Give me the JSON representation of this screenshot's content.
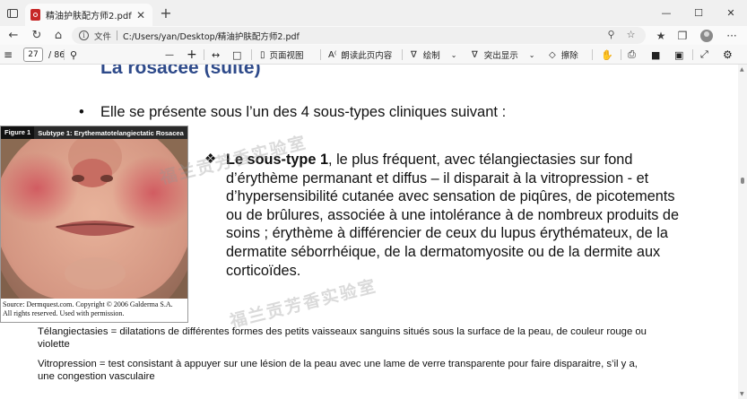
{
  "browser": {
    "tab_title": "精油护肤配方师2.pdf",
    "tab_close": "✕",
    "new_tab": "+",
    "window_controls": [
      "—",
      "☐",
      "✕"
    ],
    "file_label": "文件",
    "url": "C:/Users/yan/Desktop/精油护肤配方师2.pdf",
    "more_menu": "···"
  },
  "pdf_toolbar": {
    "current_page": "27",
    "total_pages": "/ 86",
    "zoom_out": "—",
    "zoom_in": "+",
    "page_view_label": "页面视图",
    "read_aloud_label": "朗读此页内容",
    "draw_label": "绘制",
    "highlight_label": "突出显示",
    "erase_label": "擦除"
  },
  "slide": {
    "title": "La rosacée (suite)",
    "bullet_mark": "•",
    "bullet_text": "Elle se présente sous l’un des 4 sous-types cliniques suivant :",
    "figure_label": "Figure 1",
    "figure_title": "Subtype 1: Erythematotelangiectatic Rosacea",
    "figure_credit_1": "Source: Dermquest.com. Copyright © 2006 Galderma S.A.",
    "figure_credit_2": "All rights reserved. Used with permission.",
    "subtype_mark": "❖",
    "subtype_bold": "Le sous-type 1",
    "subtype_lines": [
      ", le plus fréquent, avec télangiectasies sur fond",
      "d’érythème permanant et diffus – il disparait à la vitropression - et",
      "d’hypersensibilité cutanée avec sensation de piqûres, de picotements",
      "ou de brûlures, associée à une intolérance à de nombreux produits de",
      "soins ; érythème à différencier de ceux du lupus érythémateux, de la",
      "dermatite séborrhéique, de la dermatomyosite ou de la dermite aux",
      "corticoïdes."
    ],
    "footnotes": [
      "Télangiectasies = dilatations de différentes formes des petits vaisseaux sanguins situés sous la surface de la peau, de couleur rouge ou",
      "violette",
      "Vitropression = test consistant à appuyer sur une lésion de la peau avec une lame de verre transparente pour faire disparaitre, s’il y a,",
      "une congestion vasculaire"
    ],
    "watermark": "福兰贡芳香实验室"
  },
  "colors": {
    "title_blue": "#2e4a8a",
    "pdf_red": "#c62828"
  }
}
